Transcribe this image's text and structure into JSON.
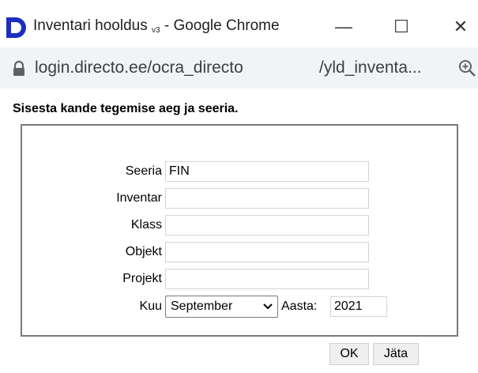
{
  "window": {
    "title_main": "Inventari hooldus",
    "title_sub": "v3",
    "title_browser": "- Google Chrome",
    "minimize_glyph": "—",
    "maximize_glyph": "☐",
    "close_glyph": "✕"
  },
  "address_bar": {
    "url_left": "login.directo.ee/ocra_directo",
    "url_right": "/yld_inventa..."
  },
  "dialog": {
    "heading": "Sisesta kande tegemise aeg ja seeria.",
    "fields": {
      "seeria": {
        "label": "Seeria",
        "value": "FIN"
      },
      "inventar": {
        "label": "Inventar",
        "value": ""
      },
      "klass": {
        "label": "Klass",
        "value": ""
      },
      "objekt": {
        "label": "Objekt",
        "value": ""
      },
      "projekt": {
        "label": "Projekt",
        "value": ""
      }
    },
    "kuu": {
      "label": "Kuu",
      "selected": "September"
    },
    "aasta": {
      "label": "Aasta:",
      "value": "2021"
    },
    "buttons": {
      "ok": "OK",
      "cancel": "Jäta"
    }
  },
  "colors": {
    "logo_blue": "#1a2fbf",
    "address_bg": "#f1f3f4",
    "panel_border": "#7a7a7a"
  }
}
